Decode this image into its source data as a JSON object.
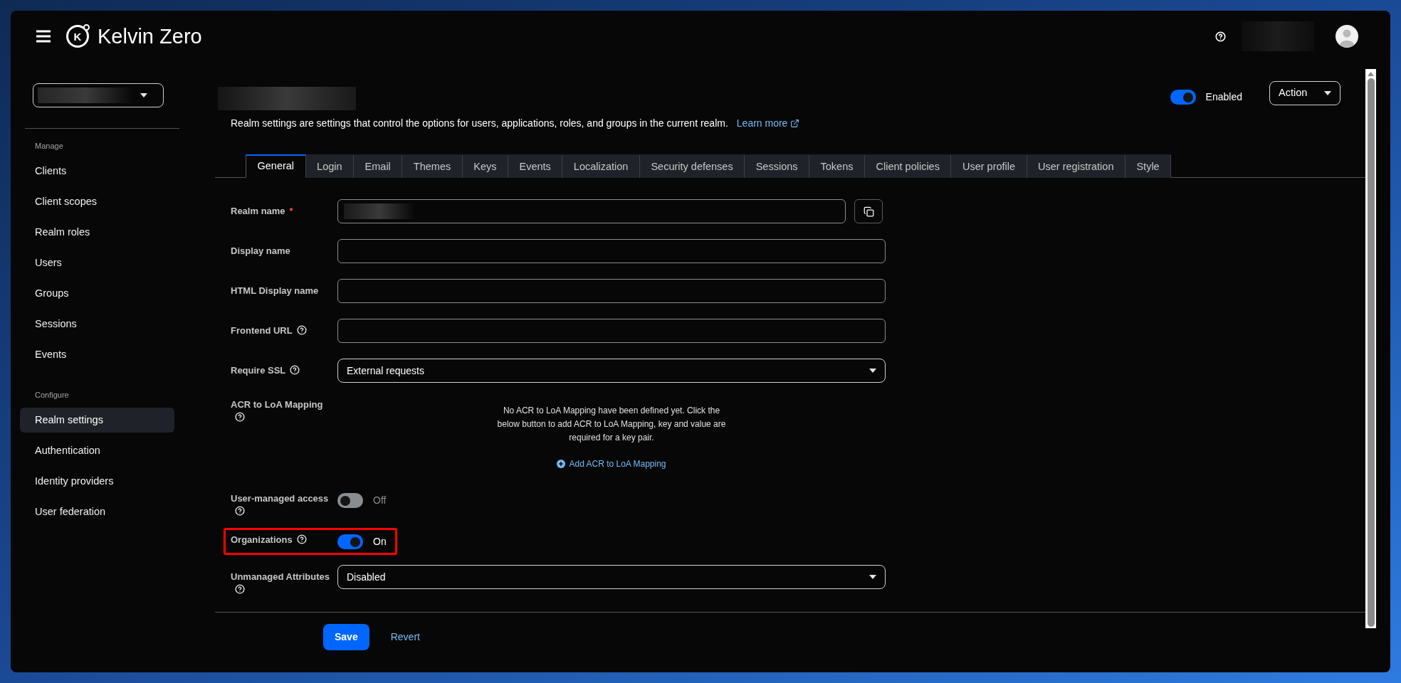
{
  "header": {
    "logo_mark": "K",
    "brand": "Kelvin Zero"
  },
  "sidebar": {
    "sections": [
      {
        "heading": "Manage",
        "items": [
          {
            "label": "Clients",
            "selected": false
          },
          {
            "label": "Client scopes",
            "selected": false
          },
          {
            "label": "Realm roles",
            "selected": false
          },
          {
            "label": "Users",
            "selected": false
          },
          {
            "label": "Groups",
            "selected": false
          },
          {
            "label": "Sessions",
            "selected": false
          },
          {
            "label": "Events",
            "selected": false
          }
        ]
      },
      {
        "heading": "Configure",
        "items": [
          {
            "label": "Realm settings",
            "selected": true
          },
          {
            "label": "Authentication",
            "selected": false
          },
          {
            "label": "Identity providers",
            "selected": false
          },
          {
            "label": "User federation",
            "selected": false
          }
        ]
      }
    ]
  },
  "page": {
    "description": "Realm settings are settings that control the options for users, applications, roles, and groups in the current realm.",
    "learn_more": "Learn more",
    "enabled_switch": {
      "label": "Enabled",
      "on": true
    },
    "action_button": "Action"
  },
  "tabs": [
    {
      "label": "General",
      "selected": true
    },
    {
      "label": "Login",
      "selected": false
    },
    {
      "label": "Email",
      "selected": false
    },
    {
      "label": "Themes",
      "selected": false
    },
    {
      "label": "Keys",
      "selected": false
    },
    {
      "label": "Events",
      "selected": false
    },
    {
      "label": "Localization",
      "selected": false
    },
    {
      "label": "Security defenses",
      "selected": false
    },
    {
      "label": "Sessions",
      "selected": false
    },
    {
      "label": "Tokens",
      "selected": false
    },
    {
      "label": "Client policies",
      "selected": false
    },
    {
      "label": "User profile",
      "selected": false
    },
    {
      "label": "User registration",
      "selected": false
    },
    {
      "label": "Style",
      "selected": false
    }
  ],
  "form": {
    "fields": [
      {
        "kind": "text",
        "label": "Realm name",
        "required_mark": "*",
        "redacted": true,
        "copy_button": true
      },
      {
        "kind": "text",
        "label": "Display name"
      },
      {
        "kind": "text",
        "label": "HTML Display name"
      },
      {
        "kind": "text",
        "label": "Frontend URL",
        "help": true
      },
      {
        "kind": "select",
        "label": "Require SSL",
        "help": true,
        "value": "External requests"
      },
      {
        "kind": "mapping",
        "label": "ACR to LoA Mapping",
        "help": true,
        "empty_text": "No ACR to LoA Mapping have been defined yet. Click the below button to add ACR to LoA Mapping, key and value are required for a key pair.",
        "add_link": "Add ACR to LoA Mapping"
      },
      {
        "kind": "switch",
        "label": "User-managed access",
        "help": true,
        "on": false,
        "state_label": "Off"
      },
      {
        "kind": "switch",
        "label": "Organizations",
        "help": true,
        "on": true,
        "state_label": "On",
        "highlighted": true
      },
      {
        "kind": "select",
        "label": "Unmanaged Attributes",
        "help": true,
        "value": "Disabled"
      }
    ],
    "save_button": "Save",
    "revert_button": "Revert"
  }
}
